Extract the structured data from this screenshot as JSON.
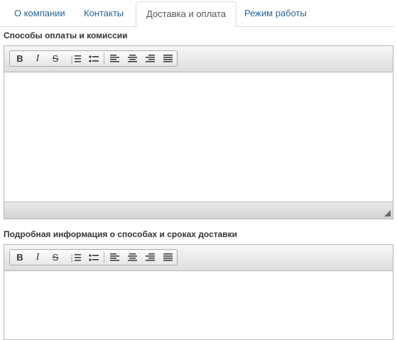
{
  "tabs": [
    {
      "label": "О компании",
      "active": false
    },
    {
      "label": "Контакты",
      "active": false
    },
    {
      "label": "Доставка и оплата",
      "active": true
    },
    {
      "label": "Режим работы",
      "active": false
    }
  ],
  "editors": [
    {
      "label": "Способы оплаты и комиссии",
      "content": ""
    },
    {
      "label": "Подробная информация о способах и сроках доставки",
      "content": ""
    }
  ],
  "toolbar": {
    "buttons": [
      "bold-icon",
      "italic-icon",
      "strikethrough-icon",
      "ordered-list-icon",
      "unordered-list-icon",
      "align-left-icon",
      "align-center-icon",
      "align-right-icon",
      "justify-icon"
    ],
    "bold_glyph": "B",
    "italic_glyph": "I",
    "strike_glyph": "S"
  },
  "colors": {
    "tab_link": "#2a6496",
    "tab_active": "#555555",
    "label": "#333333",
    "editor_border": "#b6b6b6"
  }
}
